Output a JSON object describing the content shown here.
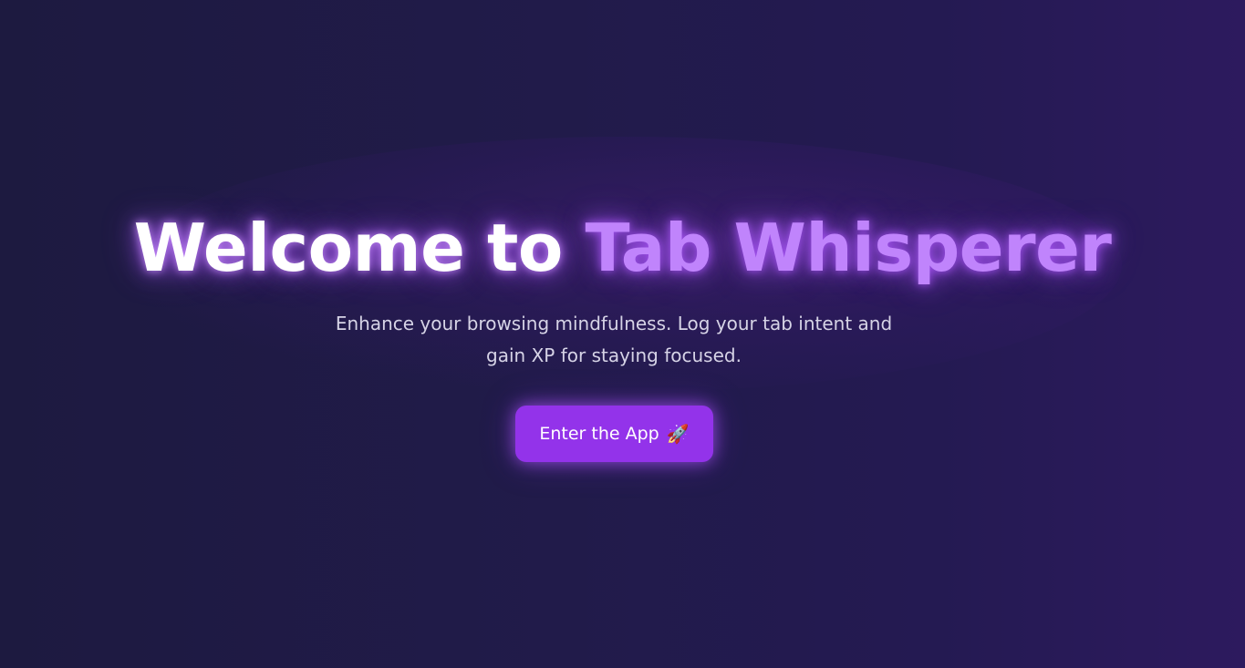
{
  "hero": {
    "title_lead": "Welcome to ",
    "title_brand": "Tab Whisperer",
    "tagline": "Enhance your browsing mindfulness. Log your tab intent and gain XP for staying focused.",
    "cta_label": "Enter the App",
    "cta_icon": "🚀",
    "cta_icon_name": "rocket-icon"
  },
  "colors": {
    "background_start": "#1d1a40",
    "background_end": "#2d1a5e",
    "accent": "#9333ea",
    "brand_text": "#c084fc",
    "tagline_text": "#d6d3e6"
  }
}
